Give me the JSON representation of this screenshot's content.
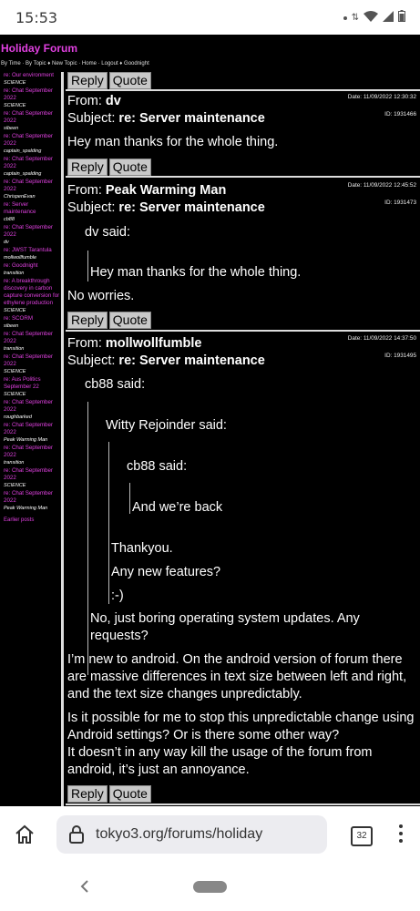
{
  "status": {
    "time": "15:53",
    "signal_badge": "5"
  },
  "forum": {
    "title": "Holiday Forum",
    "nav": [
      "By Time",
      "By Topic",
      "New Topic",
      "Home",
      "Logout",
      "Goodnight"
    ]
  },
  "sidebar": {
    "items": [
      {
        "title": "re: Our environment",
        "author": "SCIENCE"
      },
      {
        "title": "re: Chat September 2022",
        "author": "SCIENCE"
      },
      {
        "title": "re: Chat September 2022",
        "author": "sibeen"
      },
      {
        "title": "re: Chat September 2022",
        "author": "captain_spalding"
      },
      {
        "title": "re: Chat September 2022",
        "author": "captain_spalding"
      },
      {
        "title": "re: Chat September 2022",
        "author": "ChrispenEvan"
      },
      {
        "title": "re: Server maintenance",
        "author": "cb88"
      },
      {
        "title": "re: Chat September 2022",
        "author": "dv"
      },
      {
        "title": "re: JWST Tarantula",
        "author": "mollwollfumble"
      },
      {
        "title": "re: Goodnight",
        "author": "transition"
      },
      {
        "title": "re: A breakthrough discovery in carbon capture conversion for ethylene production",
        "author": "SCIENCE"
      },
      {
        "title": "re: SCORM",
        "author": "sibeen"
      },
      {
        "title": "re: Chat September 2022",
        "author": "transition"
      },
      {
        "title": "re: Chat September 2022",
        "author": "SCIENCE"
      },
      {
        "title": "re: Aus Politics September 22",
        "author": "SCIENCE"
      },
      {
        "title": "re: Chat September 2022",
        "author": "roughbarked"
      },
      {
        "title": "re: Chat September 2022",
        "author": "Peak Warming Man"
      },
      {
        "title": "re: Chat September 2022",
        "author": "transition"
      },
      {
        "title": "re: Chat September 2022",
        "author": "SCIENCE"
      },
      {
        "title": "re: Chat September 2022",
        "author": "Peak Warming Man"
      }
    ],
    "earlier": "Earlier posts"
  },
  "buttons": {
    "reply": "Reply",
    "quote": "Quote"
  },
  "labels": {
    "from": "From: ",
    "subject": "Subject: "
  },
  "posts": [
    {
      "author": "dv",
      "subject": "re: Server maintenance",
      "date": "Date: 11/09/2022 12:30:32",
      "id": "ID: 1931466",
      "body": "Hey man thanks for the whole thing."
    },
    {
      "author": "Peak Warming Man",
      "subject": "re: Server maintenance",
      "date": "Date: 11/09/2022 12:45:52",
      "id": "ID: 1931473",
      "quote_author": "dv said:",
      "quote_text": "Hey man thanks for the whole thing.",
      "body": "No worries."
    },
    {
      "author": "mollwollfumble",
      "subject": "re: Server maintenance",
      "date": "Date: 11/09/2022 14:37:50",
      "id": "ID: 1931495",
      "q1_author": "cb88 said:",
      "q2_author": "Witty Rejoinder said:",
      "q3_author": "cb88 said:",
      "q3_text": "And we’re back",
      "q2_text1": "Thankyou.",
      "q2_text2": "Any new features?",
      "q2_text3": ":-)",
      "q1_text1": "No, just boring operating system updates. Any",
      "q1_text2": "requests?",
      "body1": "I’m new to android. On the android version of forum there",
      "body2": "are massive differences in text size between left and right,",
      "body3": "and the text size changes unpredictably.",
      "body4": "Is it possible for me to stop this unpredictable change using",
      "body5": "Android settings? Or is there some other way?",
      "body6": "It doesn’t in any way kill the usage of the forum from",
      "body7": "android, it’s just an annoyance."
    }
  ],
  "browser": {
    "url": "tokyo3.org/forums/holiday",
    "tab_count": "32"
  }
}
